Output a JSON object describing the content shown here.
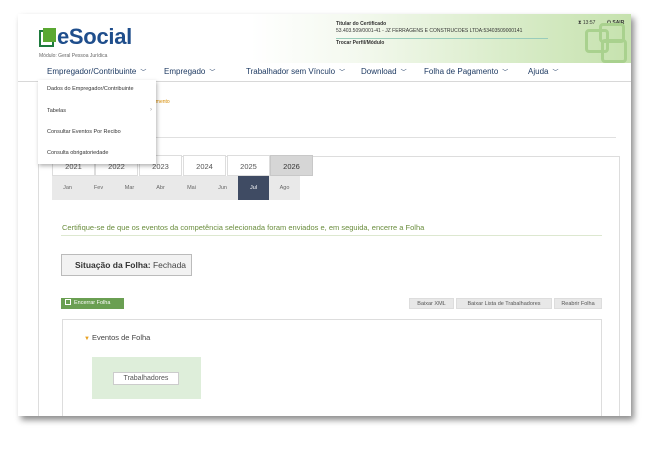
{
  "header": {
    "logo_text": "eSocial",
    "logo_sub": "Módulo: Geral Pessoa Jurídica",
    "cert_title": "Titular do Certificado",
    "cert_value": "53.403.509/0001-41 - JZ FERRAGENS E CONSTRUCOES LTDA:53403509000141",
    "cert_link": "Trocar Perfil/Módulo",
    "timer": "13:57",
    "sair": "SAIR"
  },
  "nav": {
    "items": [
      {
        "label": "Empregador/Contribuinte"
      },
      {
        "label": "Empregado"
      },
      {
        "label": "Trabalhador sem Vínculo"
      },
      {
        "label": "Download"
      },
      {
        "label": "Folha de Pagamento"
      },
      {
        "label": "Ajuda"
      }
    ],
    "dropdown": [
      {
        "label": "Dados do Empregador/Contribuinte"
      },
      {
        "label": "Tabelas"
      },
      {
        "label": "Consultar Eventos Por Recibo"
      },
      {
        "label": "Consulta obrigatoriedade"
      }
    ],
    "ghost_text": "amento"
  },
  "years": [
    "2021",
    "2022",
    "2023",
    "2024",
    "2025",
    "2026"
  ],
  "selected_year": "2026",
  "months": [
    "Jan",
    "Fev",
    "Mar",
    "Abr",
    "Mai",
    "Jun",
    "Jul",
    "Ago"
  ],
  "selected_month": "Jul",
  "notice": "Certifique-se de que os eventos da competência selecionada foram enviados e, em seguida, encerre a Folha",
  "situacao": {
    "label": "Situação da Folha:",
    "value": "Fechada"
  },
  "actions": {
    "encerrar": "Encerrar Folha",
    "baixar_xml": "Baixar XML",
    "baixar_lista": "Baixar Lista de Trabalhadores",
    "reabrir": "Reabrir Folha"
  },
  "eventos": {
    "title": "Eventos de Folha",
    "button": "Trabalhadores"
  },
  "colors": {
    "brand_blue": "#1f4e8c",
    "brand_green": "#5aa832",
    "active_month": "#3f4b63",
    "encerrar_btn": "#6a9f52"
  }
}
